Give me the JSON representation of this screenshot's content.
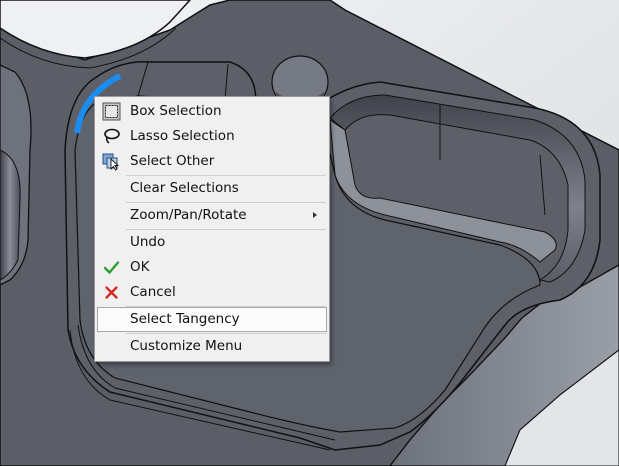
{
  "context_menu": {
    "items": [
      {
        "label": "Box Selection",
        "icon": "box-selection-icon"
      },
      {
        "label": "Lasso Selection",
        "icon": "lasso-selection-icon"
      },
      {
        "label": "Select Other",
        "icon": "select-other-icon"
      },
      {
        "label": "Clear Selections",
        "icon": ""
      },
      {
        "label": "Zoom/Pan/Rotate",
        "icon": "",
        "submenu": true
      },
      {
        "label": "Undo",
        "icon": ""
      },
      {
        "label": "OK",
        "icon": "checkmark-icon"
      },
      {
        "label": "Cancel",
        "icon": "cancel-x-icon"
      },
      {
        "label": "Select Tangency",
        "icon": "",
        "highlighted": true
      },
      {
        "label": "Customize Menu",
        "icon": ""
      }
    ]
  },
  "colors": {
    "model_face": "#5b5e67",
    "model_edge": "#101114",
    "selection_highlight": "#1c8df0",
    "background": "#e6e8ec",
    "ok_green": "#2ea02e",
    "cancel_red": "#d42a1e"
  }
}
